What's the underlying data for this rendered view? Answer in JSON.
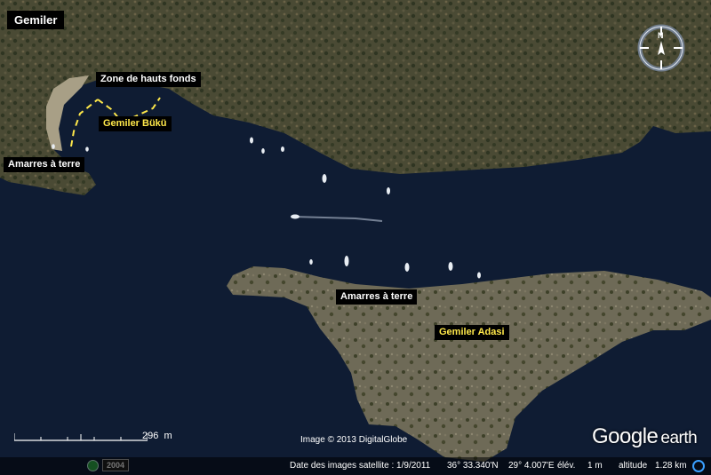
{
  "labels": {
    "place": "Gemiler",
    "shallows": "Zone de hauts fonds",
    "bay": "Gemiler Bükü",
    "mooring_left": "Amarres à terre",
    "mooring_island": "Amarres à terre",
    "island": "Gemiler Adasi"
  },
  "compass": {
    "north": "N"
  },
  "scale": {
    "value": "296",
    "unit": "m"
  },
  "imagery": {
    "credit": "Image © 2013 DigitalGlobe",
    "year": "2004"
  },
  "logo": {
    "brand": "Google",
    "product": "earth"
  },
  "status": {
    "date_label": "Date des images satellite : 1/9/2011",
    "latitude": "36° 33.340'N",
    "longitude": "29° 4.007'E",
    "elev_label": "élév.",
    "elev_value": "1 m",
    "altitude_label": "altitude",
    "altitude_value": "1.28 km"
  },
  "colors": {
    "sea": "#0f1c33",
    "land": "#4d4a33",
    "label_yellow": "#ffe84a",
    "label_bg": "#000000"
  }
}
